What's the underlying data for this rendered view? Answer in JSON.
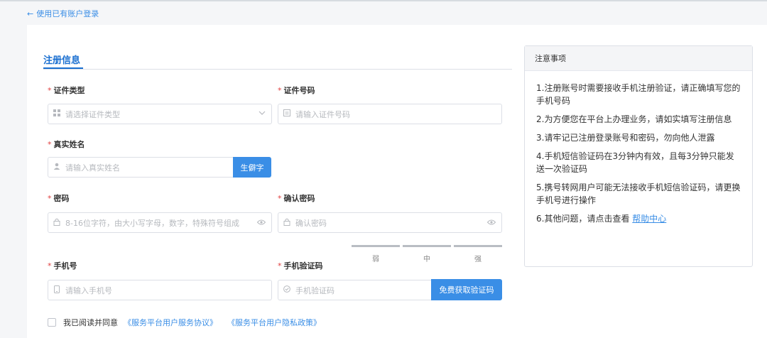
{
  "nav": {
    "back_arrow": "←",
    "back_label": "使用已有账户登录"
  },
  "tab": {
    "label": "注册信息"
  },
  "form": {
    "required_mark": "*",
    "id_type": {
      "label": "证件类型",
      "placeholder": "请选择证件类型",
      "icon": "grid-icon",
      "tail_icon": "chevron-down-icon"
    },
    "id_number": {
      "label": "证件号码",
      "placeholder": "请输入证件号码",
      "icon": "id-card-icon"
    },
    "real_name": {
      "label": "真实姓名",
      "placeholder": "请输入真实姓名",
      "icon": "user-icon",
      "button": "生僻字"
    },
    "password": {
      "label": "密码",
      "placeholder": "8-16位字符，由大小写字母，数字，特殊符号组成",
      "icon": "lock-icon",
      "tail_icon": "eye-icon"
    },
    "confirm_password": {
      "label": "确认密码",
      "placeholder": "确认密码",
      "icon": "lock-icon",
      "tail_icon": "eye-icon"
    },
    "strength": [
      "弱",
      "中",
      "强"
    ],
    "phone": {
      "label": "手机号",
      "placeholder": "请输入手机号",
      "icon": "phone-icon"
    },
    "sms_code": {
      "label": "手机验证码",
      "placeholder": "手机验证码",
      "icon": "check-circle-icon",
      "button": "免费获取验证码"
    },
    "agree": {
      "prefix": "我已阅读并同意",
      "service_link": "《服务平台用户服务协议》",
      "privacy_link": "《服务平台用户隐私政策》"
    }
  },
  "notes": {
    "title": "注意事项",
    "items": [
      "1.注册账号时需要接收手机注册验证，请正确填写您的手机号码",
      "2.为方便您在平台上办理业务，请如实填写注册信息",
      "3.请牢记已注册登录账号和密码，勿向他人泄露",
      "4.手机短信验证码在3分钟内有效，且每3分钟只能发送一次验证码",
      "5.携号转网用户可能无法接收手机短信验证码，请更换手机号进行操作"
    ],
    "last_prefix": "6.其他问题，请点击查看",
    "help_link": "帮助中心"
  },
  "colors": {
    "accent": "#3a8ee6",
    "required": "#e04040",
    "tab": "#1a6fd0"
  }
}
